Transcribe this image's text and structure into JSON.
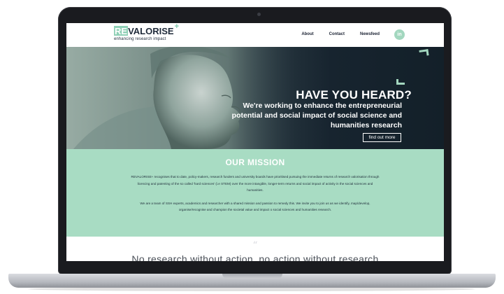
{
  "logo": {
    "prefix": "RE",
    "name": "VALORISE",
    "plus": "+",
    "tagline": "enhancing research impact"
  },
  "nav": {
    "about": "About",
    "contact": "Contact",
    "newsfeed": "Newsfeed",
    "linkedin": "in"
  },
  "hero": {
    "heading": "HAVE YOU HEARD?",
    "subheading": "We're working to enhance the entrepreneurial potential and social impact of social science and humanities research",
    "button": "find out more"
  },
  "mission": {
    "title": "OUR MISSION",
    "paragraph1": "REVALORISE+ recognises that to date, policy-makers, research funders and university boards have prioritised pursuing the immediate returns of research valorisation through licencing and patenting of the so called 'hard sciences' (i.e STEM) over the more intangible, longer-term returns and social impact of activity in the social sciences and humanities.",
    "paragraph2": "We are a team of SSH experts, academics and researcher with a shared mission and passion to remedy this. We invite you to join us as we identify, map/develop, organise/recognise and champion the societal value and impact o social sciences and humanities research."
  },
  "quote": {
    "mark": "“",
    "text": "No research without action, no action without research"
  },
  "colors": {
    "accent": "#a8dcc3",
    "dark": "#17242f"
  }
}
